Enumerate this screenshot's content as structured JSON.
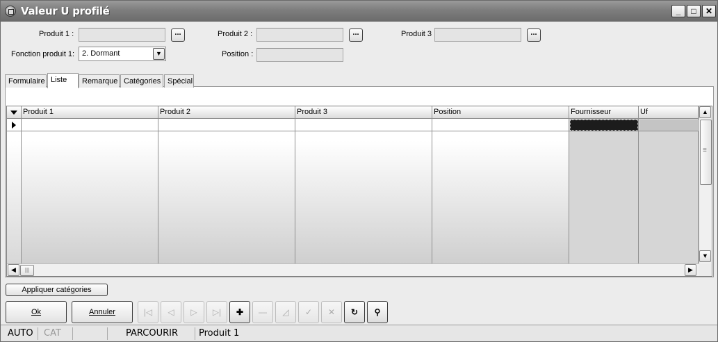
{
  "window": {
    "title": "Valeur U profilé"
  },
  "form": {
    "produit1_label": "Produit 1 :",
    "produit2_label": "Produit 2 :",
    "produit3_label": "Produit 3",
    "fonction_label": "Fonction produit 1:",
    "fonction_value": "2.  Dormant",
    "position_label": "Position :",
    "browse_label": "..."
  },
  "tabs": [
    {
      "label": "Formulaire"
    },
    {
      "label": "Liste"
    },
    {
      "label": "Remarque"
    },
    {
      "label": "Catégories"
    },
    {
      "label": "Spécial"
    }
  ],
  "grid": {
    "columns": [
      "Produit 1",
      "Produit 2",
      "Produit 3",
      "Position",
      "Fournisseur",
      "Uf"
    ]
  },
  "buttons": {
    "apply_categories": "Appliquer catégories",
    "ok": "Ok",
    "cancel": "Annuler"
  },
  "nav_icons": [
    "first-icon",
    "prev-icon",
    "next-icon",
    "last-icon",
    "add-icon",
    "delete-icon",
    "edit-icon",
    "confirm-icon",
    "cancel-edit-icon",
    "refresh-icon",
    "find-icon"
  ],
  "status": {
    "mode": "AUTO",
    "cat": "CAT",
    "state": "PARCOURIR",
    "field": "Produit 1"
  }
}
